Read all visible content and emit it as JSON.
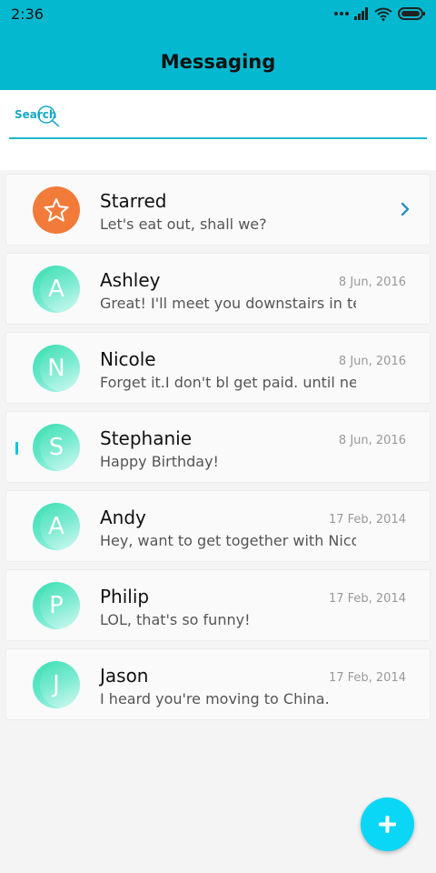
{
  "status_bar": {
    "time": "2:36"
  },
  "header": {
    "title": "Messaging"
  },
  "search": {
    "label": "Search",
    "value": "",
    "placeholder": ""
  },
  "colors": {
    "accent": "#04b8cf",
    "starred": "#f27b3a",
    "fab": "#0ad7f5",
    "avatar": "#3ddfb2"
  },
  "starred": {
    "name": "Starred",
    "preview": "Let's eat out, shall we?",
    "icon": "star-icon"
  },
  "conversations": [
    {
      "initial": "A",
      "name": "Ashley",
      "date": "8 Jun, 2016",
      "preview": "Great! I'll meet you downstairs in ten …"
    },
    {
      "initial": "N",
      "name": "Nicole",
      "date": "8 Jun, 2016",
      "preview": "Forget it.I don't bl get paid. until next F…"
    },
    {
      "initial": "S",
      "name": "Stephanie",
      "date": "8 Jun, 2016",
      "preview": "Happy Birthday!"
    },
    {
      "initial": "A",
      "name": "Andy",
      "date": "17 Feb, 2014",
      "preview": "Hey, want to get together with Nicole …"
    },
    {
      "initial": "P",
      "name": "Philip",
      "date": "17 Feb, 2014",
      "preview": "LOL, that's so funny!"
    },
    {
      "initial": "J",
      "name": "Jason",
      "date": "17 Feb, 2014",
      "preview": "I heard you're moving to China."
    }
  ],
  "fab": {
    "icon": "plus-icon"
  }
}
